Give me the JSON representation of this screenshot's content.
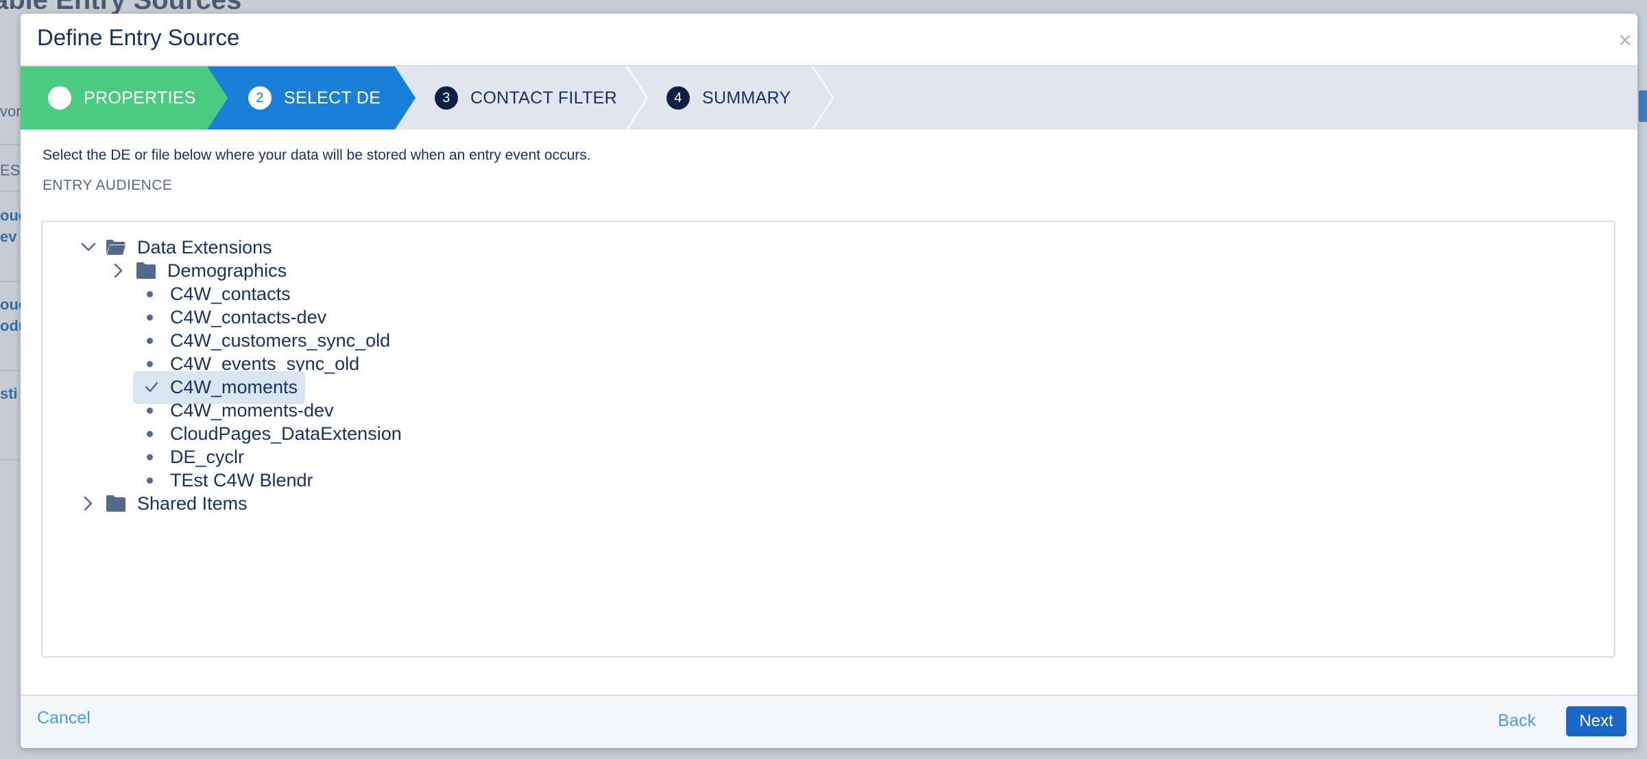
{
  "background": {
    "title_fragment": "able Entry Sources",
    "left_fragments": [
      "vor",
      "ES",
      "ouc",
      "ev",
      "ouc",
      "odu",
      "sti"
    ]
  },
  "modal": {
    "title": "Define Entry Source",
    "close_symbol": "×"
  },
  "wizard": {
    "steps": [
      {
        "number": "",
        "label": "PROPERTIES",
        "state": "complete",
        "color": "#4bca81"
      },
      {
        "number": "2",
        "label": "SELECT DE",
        "state": "current",
        "color": "#1a7fd6"
      },
      {
        "number": "3",
        "label": "CONTACT FILTER",
        "state": "todo",
        "color": "#e0e5ee"
      },
      {
        "number": "4",
        "label": "SUMMARY",
        "state": "todo",
        "color": "#e0e5ee"
      }
    ]
  },
  "body": {
    "instruction": "Select the DE or file below where your data will be stored when an entry event occurs.",
    "section_label": "ENTRY AUDIENCE"
  },
  "tree": {
    "root_folder": {
      "label": "Data Extensions",
      "expanded": true,
      "icon": "open-folder-icon"
    },
    "subfolder": {
      "label": "Demographics",
      "expanded": false,
      "icon": "folder-icon"
    },
    "items": [
      "C4W_contacts",
      "C4W_contacts-dev",
      "C4W_customers_sync_old",
      "C4W_events_sync_old",
      "C4W_moments",
      "C4W_moments-dev",
      "CloudPages_DataExtension",
      "DE_cyclr",
      "TEst C4W Blendr"
    ],
    "selected_item": "C4W_moments",
    "shared_folder": {
      "label": "Shared Items",
      "expanded": false,
      "icon": "folder-icon"
    }
  },
  "footer": {
    "cancel_label": "Cancel",
    "back_label": "Back",
    "next_label": "Next"
  },
  "colors": {
    "accent": "#1a66c7",
    "complete": "#4bca81",
    "current": "#1a7fd6",
    "text": "#16325c",
    "selection_bg": "#d8e6f2"
  }
}
